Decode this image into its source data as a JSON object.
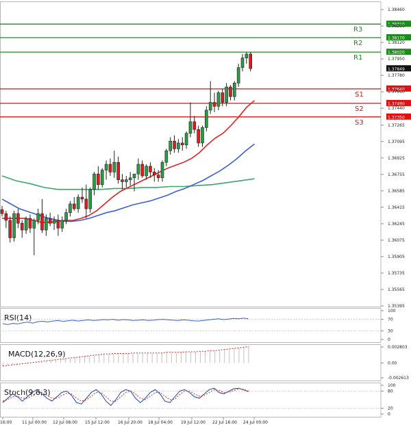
{
  "chart_data": {
    "type": "candlestick",
    "symbol_panel": {
      "price_ticks": [
        "1.38460",
        "1.38290",
        "1.38120",
        "1.37950",
        "1.37780",
        "1.37610",
        "1.37440",
        "1.37265",
        "1.37095",
        "1.36925",
        "1.36755",
        "1.36585",
        "1.36415",
        "1.36245",
        "1.36075",
        "1.35905",
        "1.35735",
        "1.35565",
        "1.35395"
      ],
      "current_price": "1.37849",
      "levels": [
        {
          "name": "R3",
          "value": "1.38310",
          "price": 1.3831,
          "color": "#1e8a1e"
        },
        {
          "name": "R2",
          "value": "1.38170",
          "price": 1.3817,
          "color": "#1e8a1e"
        },
        {
          "name": "R1",
          "value": "1.38020",
          "price": 1.3802,
          "color": "#1e8a1e"
        },
        {
          "name": "S1",
          "value": "1.37640",
          "price": 1.3764,
          "color": "#dd1111"
        },
        {
          "name": "S2",
          "value": "1.37490",
          "price": 1.3749,
          "color": "#dd1111"
        },
        {
          "name": "S3",
          "value": "1.37350",
          "price": 1.3735,
          "color": "#dd1111"
        }
      ],
      "candles": [
        [
          1.3639,
          1.3643,
          1.3632,
          1.3635
        ],
        [
          1.3635,
          1.3638,
          1.362,
          1.3628
        ],
        [
          1.3628,
          1.3632,
          1.3605,
          1.361
        ],
        [
          1.361,
          1.3638,
          1.3606,
          1.3635
        ],
        [
          1.3635,
          1.364,
          1.362,
          1.3625
        ],
        [
          1.3625,
          1.3628,
          1.361,
          1.3618
        ],
        [
          1.3618,
          1.3632,
          1.3614,
          1.363
        ],
        [
          1.363,
          1.3634,
          1.3615,
          1.362
        ],
        [
          1.362,
          1.363,
          1.3592,
          1.3628
        ],
        [
          1.3628,
          1.364,
          1.3624,
          1.3635
        ],
        [
          1.3635,
          1.365,
          1.3615,
          1.3618
        ],
        [
          1.3618,
          1.3634,
          1.3612,
          1.363
        ],
        [
          1.363,
          1.3636,
          1.3622,
          1.3625
        ],
        [
          1.3625,
          1.3632,
          1.3618,
          1.3628
        ],
        [
          1.3628,
          1.3634,
          1.3612,
          1.362
        ],
        [
          1.362,
          1.3632,
          1.3616,
          1.3628
        ],
        [
          1.3628,
          1.364,
          1.3624,
          1.3636
        ],
        [
          1.3636,
          1.3648,
          1.3632,
          1.3645
        ],
        [
          1.3645,
          1.3652,
          1.3638,
          1.364
        ],
        [
          1.364,
          1.3655,
          1.3636,
          1.3652
        ],
        [
          1.3652,
          1.3662,
          1.3646,
          1.365
        ],
        [
          1.365,
          1.3665,
          1.363,
          1.364
        ],
        [
          1.364,
          1.3662,
          1.3636,
          1.366
        ],
        [
          1.366,
          1.3678,
          1.3654,
          1.3676
        ],
        [
          1.3676,
          1.3684,
          1.366,
          1.3665
        ],
        [
          1.3665,
          1.3682,
          1.3662,
          1.368
        ],
        [
          1.368,
          1.369,
          1.367,
          1.3686
        ],
        [
          1.3686,
          1.3692,
          1.3674,
          1.3678
        ],
        [
          1.3678,
          1.37,
          1.3672,
          1.3688
        ],
        [
          1.3688,
          1.3694,
          1.3666,
          1.367
        ],
        [
          1.367,
          1.3676,
          1.366,
          1.3668
        ],
        [
          1.3668,
          1.3674,
          1.3662,
          1.367
        ],
        [
          1.367,
          1.3678,
          1.3664,
          1.3672
        ],
        [
          1.3672,
          1.3676,
          1.3658,
          1.3676
        ],
        [
          1.3676,
          1.3692,
          1.367,
          1.3686
        ],
        [
          1.3686,
          1.369,
          1.3672,
          1.3674
        ],
        [
          1.3674,
          1.3686,
          1.367,
          1.3684
        ],
        [
          1.3684,
          1.3688,
          1.3672,
          1.3678
        ],
        [
          1.3678,
          1.3682,
          1.3668,
          1.3675
        ],
        [
          1.3675,
          1.368,
          1.3668,
          1.3672
        ],
        [
          1.3672,
          1.369,
          1.3668,
          1.3688
        ],
        [
          1.3688,
          1.3702,
          1.3684,
          1.37
        ],
        [
          1.37,
          1.3714,
          1.3696,
          1.371
        ],
        [
          1.371,
          1.3716,
          1.3698,
          1.3702
        ],
        [
          1.3702,
          1.3712,
          1.3698,
          1.3708
        ],
        [
          1.3708,
          1.3714,
          1.37,
          1.3706
        ],
        [
          1.3706,
          1.372,
          1.3702,
          1.3718
        ],
        [
          1.3718,
          1.375,
          1.3714,
          1.373
        ],
        [
          1.373,
          1.3736,
          1.3718,
          1.3722
        ],
        [
          1.3722,
          1.3726,
          1.3704,
          1.3708
        ],
        [
          1.3708,
          1.3726,
          1.3704,
          1.3724
        ],
        [
          1.3724,
          1.3746,
          1.372,
          1.3742
        ],
        [
          1.3742,
          1.3772,
          1.3738,
          1.375
        ],
        [
          1.375,
          1.376,
          1.374,
          1.3746
        ],
        [
          1.3746,
          1.3762,
          1.3742,
          1.376
        ],
        [
          1.376,
          1.3764,
          1.3746,
          1.375
        ],
        [
          1.375,
          1.377,
          1.3746,
          1.3766
        ],
        [
          1.3766,
          1.3768,
          1.3752,
          1.3756
        ],
        [
          1.3756,
          1.3772,
          1.3752,
          1.377
        ],
        [
          1.377,
          1.379,
          1.3766,
          1.3786
        ],
        [
          1.3786,
          1.38,
          1.3782,
          1.3796
        ],
        [
          1.3796,
          1.3802,
          1.379,
          1.38
        ],
        [
          1.38,
          1.3802,
          1.3782,
          1.3785
        ]
      ],
      "ma_fast": [
        [
          1.363,
          1.363,
          1.363,
          1.363,
          1.3628,
          1.3626,
          1.3626,
          1.3627,
          1.3628,
          1.3628,
          1.363,
          1.3633,
          1.3638,
          1.3645,
          1.3652,
          1.3658,
          1.3662,
          1.3666,
          1.367,
          1.3674,
          1.3678,
          1.3682,
          1.3685,
          1.3688,
          1.3692,
          1.3698,
          1.3706,
          1.3713,
          1.3718,
          1.3726,
          1.3735,
          1.3745,
          1.3752
        ]
      ],
      "ma_mid": [
        [
          1.365,
          1.3645,
          1.364,
          1.3637,
          1.3634,
          1.3631,
          1.3629,
          1.3627,
          1.3627,
          1.3628,
          1.363,
          1.3633,
          1.3636,
          1.3638,
          1.3641,
          1.3644,
          1.3646,
          1.3648,
          1.3651,
          1.3654,
          1.3658,
          1.3661,
          1.3665,
          1.3669,
          1.3674,
          1.3679,
          1.3685,
          1.3692,
          1.37,
          1.3707
        ]
      ],
      "ma_slow": [
        [
          1.3674,
          1.3669,
          1.3666,
          1.3662,
          1.366,
          1.366,
          1.366,
          1.366,
          1.3661,
          1.3661,
          1.3662,
          1.3662,
          1.3663,
          1.3663,
          1.3664,
          1.3665,
          1.3667,
          1.3669,
          1.3671
        ]
      ]
    },
    "x_labels": [
      "16:00",
      "11 Jul 00:00",
      "12 Jul 08:00",
      "15 Jul 12:00",
      "16 Jul 20:00",
      "18 Jul 04:00",
      "19 Jul 12:00",
      "22 Jul 16:00",
      "24 Jul 00:00"
    ],
    "indicators": [
      {
        "name": "RSI(14)",
        "label": "RSI(14)",
        "ticks": [
          "100",
          "70",
          "30",
          "0"
        ],
        "values": [
          55,
          52,
          56,
          54,
          58,
          60,
          57,
          62,
          63,
          61,
          64,
          66,
          63,
          65,
          67,
          64,
          66,
          68,
          66,
          67,
          69,
          68,
          70,
          67,
          69,
          68,
          66,
          67,
          68,
          66,
          67,
          69,
          70,
          68,
          67,
          66,
          68,
          67,
          65,
          64,
          66,
          68,
          70,
          72,
          69,
          71,
          73,
          72,
          74,
          72
        ]
      },
      {
        "name": "MACD",
        "label": "MACD(12,26,9)",
        "ticks": [
          "0.002803",
          "0.00",
          "-0.002613"
        ],
        "values": [
          -0.0006,
          -0.0005,
          -0.0004,
          -0.0003,
          -0.0002,
          -0.0001,
          0.0,
          0.0001,
          0.0002,
          0.0003,
          0.0004,
          0.0005,
          0.0006,
          0.0007,
          0.0008,
          0.0009,
          0.001,
          0.0011,
          0.0012,
          0.0013,
          0.0014,
          0.0015,
          0.0015,
          0.0016,
          0.0016,
          0.0016,
          0.0016,
          0.0017,
          0.0017,
          0.0017,
          0.0017,
          0.0017,
          0.0017,
          0.0017,
          0.0018,
          0.0018,
          0.0018,
          0.0018,
          0.0019,
          0.0019,
          0.0019,
          0.002,
          0.002,
          0.0021,
          0.0021,
          0.0022,
          0.0023,
          0.0024,
          0.0025,
          0.0026,
          0.0027,
          0.0028
        ]
      },
      {
        "name": "Stoch",
        "label": "Stoch(9,6,3)",
        "ticks": [
          "100",
          "80",
          "20",
          "0"
        ],
        "main": [
          40,
          55,
          70,
          60,
          45,
          60,
          75,
          85,
          70,
          55,
          45,
          60,
          75,
          80,
          65,
          40,
          35,
          55,
          75,
          85,
          70,
          45,
          30,
          50,
          75,
          85,
          80,
          55,
          40,
          55,
          75,
          85,
          70,
          45,
          40,
          60,
          80,
          85,
          75,
          60,
          55,
          70,
          85,
          90,
          75,
          70,
          80,
          88,
          90,
          84,
          78
        ],
        "signal": [
          45,
          50,
          60,
          62,
          55,
          55,
          65,
          75,
          75,
          65,
          55,
          55,
          65,
          72,
          70,
          55,
          45,
          50,
          62,
          75,
          75,
          60,
          45,
          45,
          60,
          75,
          80,
          70,
          55,
          50,
          62,
          75,
          75,
          62,
          50,
          52,
          68,
          80,
          80,
          70,
          62,
          65,
          75,
          85,
          82,
          75,
          76,
          82,
          88,
          86,
          80
        ]
      }
    ]
  }
}
